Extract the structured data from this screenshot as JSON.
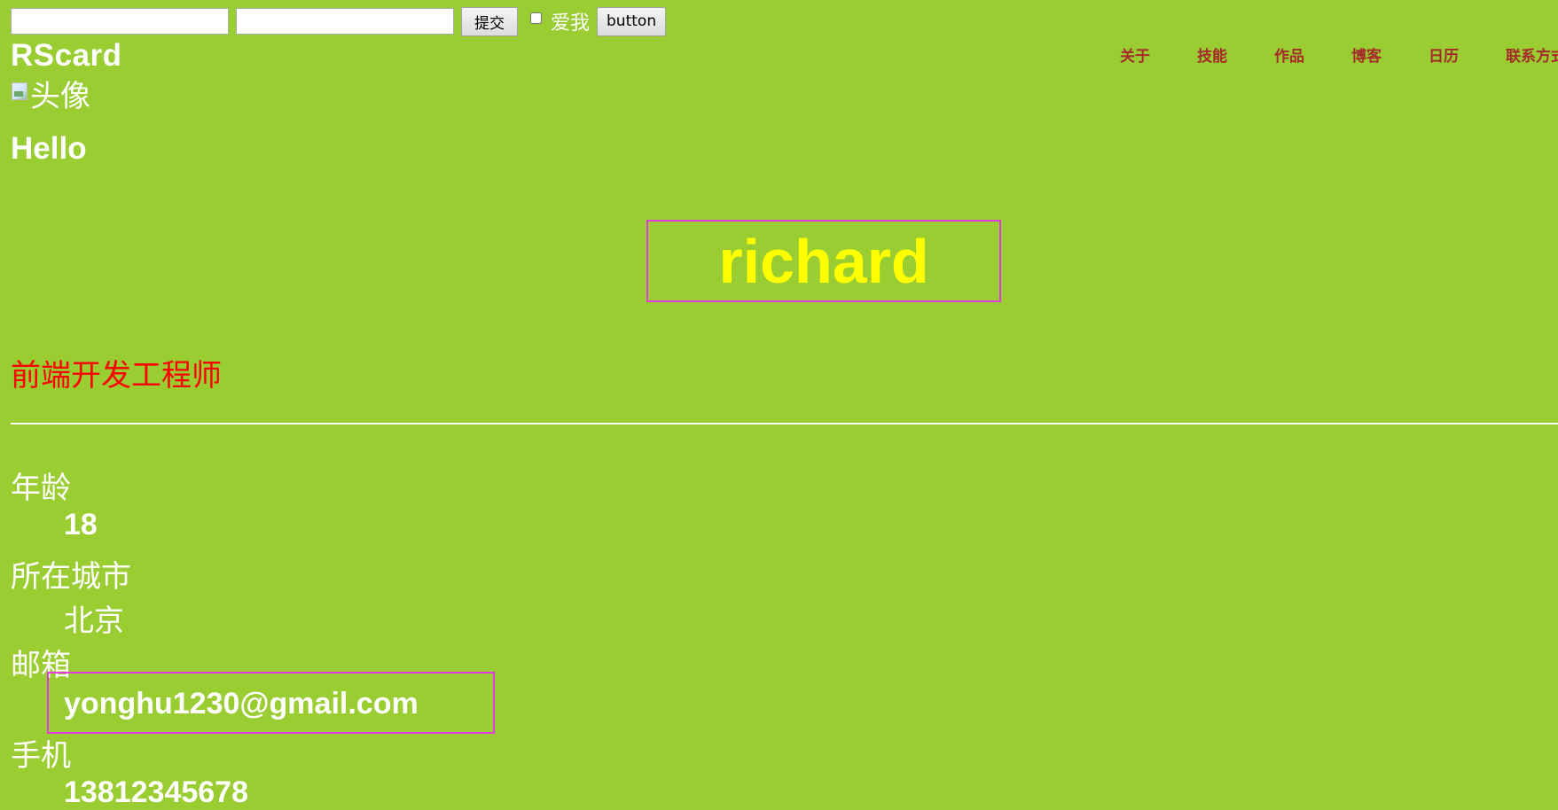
{
  "form": {
    "input1_value": "",
    "input2_value": "",
    "submit_label": "提交",
    "checkbox_label": "爱我",
    "button_label": "button"
  },
  "header": {
    "brand": "RScard",
    "nav": [
      "关于",
      "技能",
      "作品",
      "博客",
      "日历",
      "联系方式"
    ]
  },
  "profile": {
    "avatar_alt": "头像",
    "greeting": "Hello",
    "name": "richard",
    "title": "前端开发工程师"
  },
  "info": {
    "age_label": "年龄",
    "age_value": "18",
    "city_label": "所在城市",
    "city_value": "北京",
    "email_label": "邮箱",
    "email_value": "yonghu1230@gmail.com",
    "phone_label": "手机",
    "phone_value": "13812345678"
  },
  "colors": {
    "background": "#9acd32",
    "name_color": "#ffff00",
    "title_color": "#ff0000",
    "nav_color": "#a52a2a",
    "highlight_border": "#e23be2"
  }
}
